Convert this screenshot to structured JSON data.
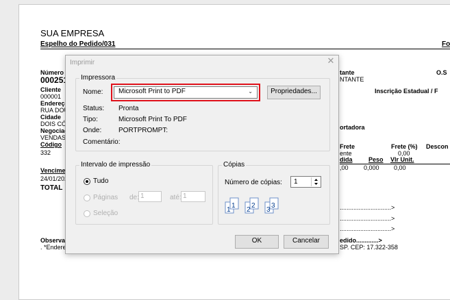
{
  "report": {
    "company": "SUA EMPRESA",
    "title": "Espelho do Pedido/031",
    "fo_cut": "Fo",
    "numero_label": "Número",
    "numero_value": "000251",
    "cliente_label": "Cliente",
    "cliente_value": "000001",
    "endereco_label": "Endereço",
    "endereco_value": "RUA DOU",
    "cidade_label": "Cidade",
    "cidade_value": "DOIS CÓR",
    "negociacao_label": "Negociaç",
    "negociacao_value": "VENDAS",
    "codigo_label": "Código",
    "codigo_value": "332",
    "vencimento_label": "Vencimen",
    "vencimento_value": "24/01/202",
    "total_label": "TOTAL",
    "observacao_label": "Observaç",
    "observacao_value": ". *Endereç",
    "right": {
      "tante": "tante",
      "ntante": "NTANTE",
      "os": "O.S",
      "inscricao": "Inscrição Estadual / F",
      "portadora": "ortadora",
      "frete_label": "Frete",
      "frete_pct": "Frete (%)",
      "descon": "Descon",
      "ente": "ente",
      "ente_val": "0,00",
      "dida": "dida",
      "peso": "Peso",
      "vlr_unit": "Vlr Unit.",
      "row_qty": ",00",
      "row_peso": "0,000",
      "row_vlr": "0,00",
      "dots1": "..............................>",
      "dots2": "..............................>",
      "dots3": "..............................>",
      "pedido": "edido.............>",
      "cep": "SP.  CEP: 17.322-358"
    }
  },
  "dialog": {
    "title": "Imprimir",
    "close": "✕",
    "printer_group": "Impressora",
    "name_label": "Nome:",
    "printer_name": "Microsoft Print to PDF",
    "properties_button": "Propriedades...",
    "status_label": "Status:",
    "status_value": "Pronta",
    "type_label": "Tipo:",
    "type_value": "Microsoft Print To PDF",
    "where_label": "Onde:",
    "where_value": "PORTPROMPT:",
    "comment_label": "Comentário:",
    "range_group": "Intervalo de impressão",
    "all_label": "Tudo",
    "pages_label": "Páginas",
    "from_label": "de:",
    "from_value": "1",
    "to_label": "até:",
    "to_value": "1",
    "selection_label": "Seleção",
    "copies_group": "Cópias",
    "copies_label": "Número de cópias:",
    "copies_value": "1",
    "ok_button": "OK",
    "cancel_button": "Cancelar",
    "highlight_color": "#e0101a"
  }
}
